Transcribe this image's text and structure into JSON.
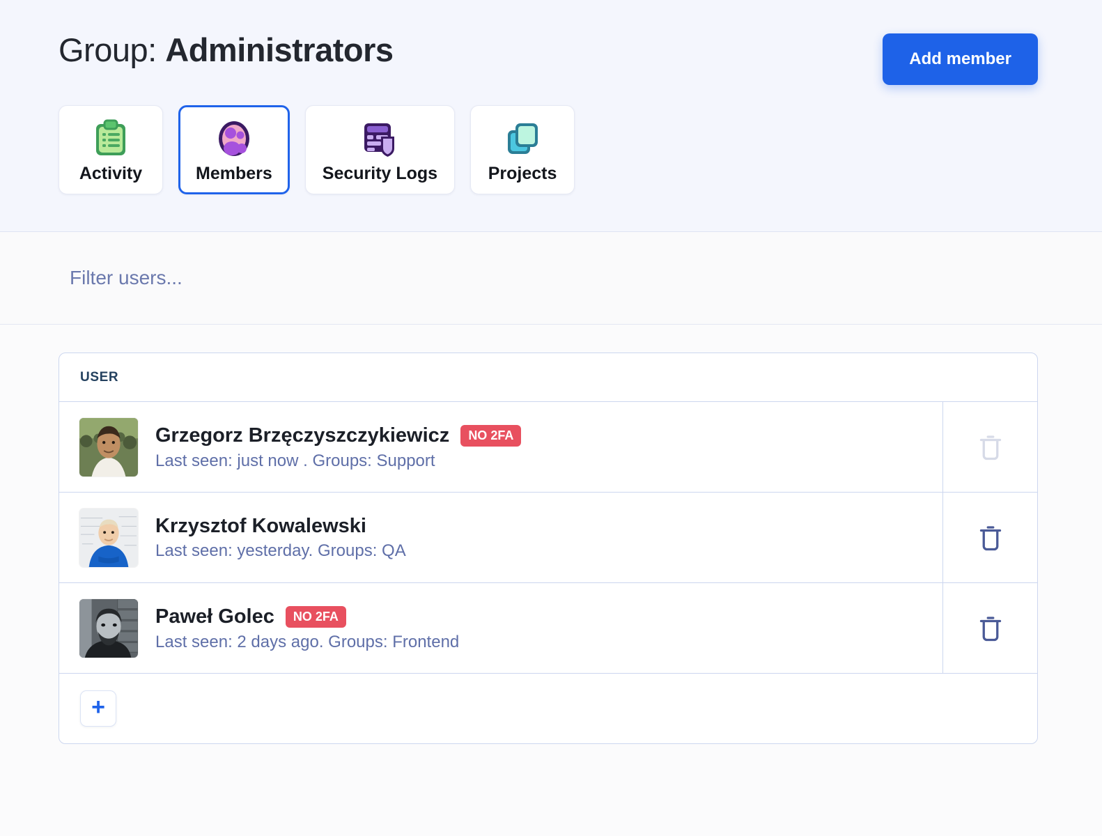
{
  "header": {
    "title_prefix": "Group:",
    "title_name": "Administrators",
    "add_member_label": "Add member"
  },
  "tabs": [
    {
      "label": "Activity",
      "icon": "clipboard-icon",
      "active": false
    },
    {
      "label": "Members",
      "icon": "user-group-icon",
      "active": true
    },
    {
      "label": "Security Logs",
      "icon": "shield-document-icon",
      "active": false
    },
    {
      "label": "Projects",
      "icon": "stacked-cards-icon",
      "active": false
    }
  ],
  "filter": {
    "placeholder": "Filter users...",
    "value": ""
  },
  "table": {
    "columns": [
      "USER"
    ],
    "rows": [
      {
        "name": "Grzegorz Brzęczyszczykiewicz",
        "badge": "NO 2FA",
        "meta": "Last seen: just now . Groups: Support",
        "avatar": "man-white-shirt-outdoors",
        "delete_disabled": true
      },
      {
        "name": "Krzysztof Kowalewski",
        "badge": "",
        "meta": "Last seen: yesterday. Groups: QA",
        "avatar": "man-blue-sweater-whiteboard",
        "delete_disabled": false
      },
      {
        "name": "Paweł Golec",
        "badge": "NO 2FA",
        "meta": "Last seen: 2 days ago. Groups: Frontend",
        "avatar": "man-beard-bw-brickwall",
        "delete_disabled": false
      }
    ],
    "add_row_label": "+"
  },
  "colors": {
    "accent_blue": "#1e62e8",
    "badge_red": "#e8505f",
    "header_band": "#f4f6fd",
    "meta_text": "#5f6fa8",
    "table_border": "#ccd6ef"
  }
}
